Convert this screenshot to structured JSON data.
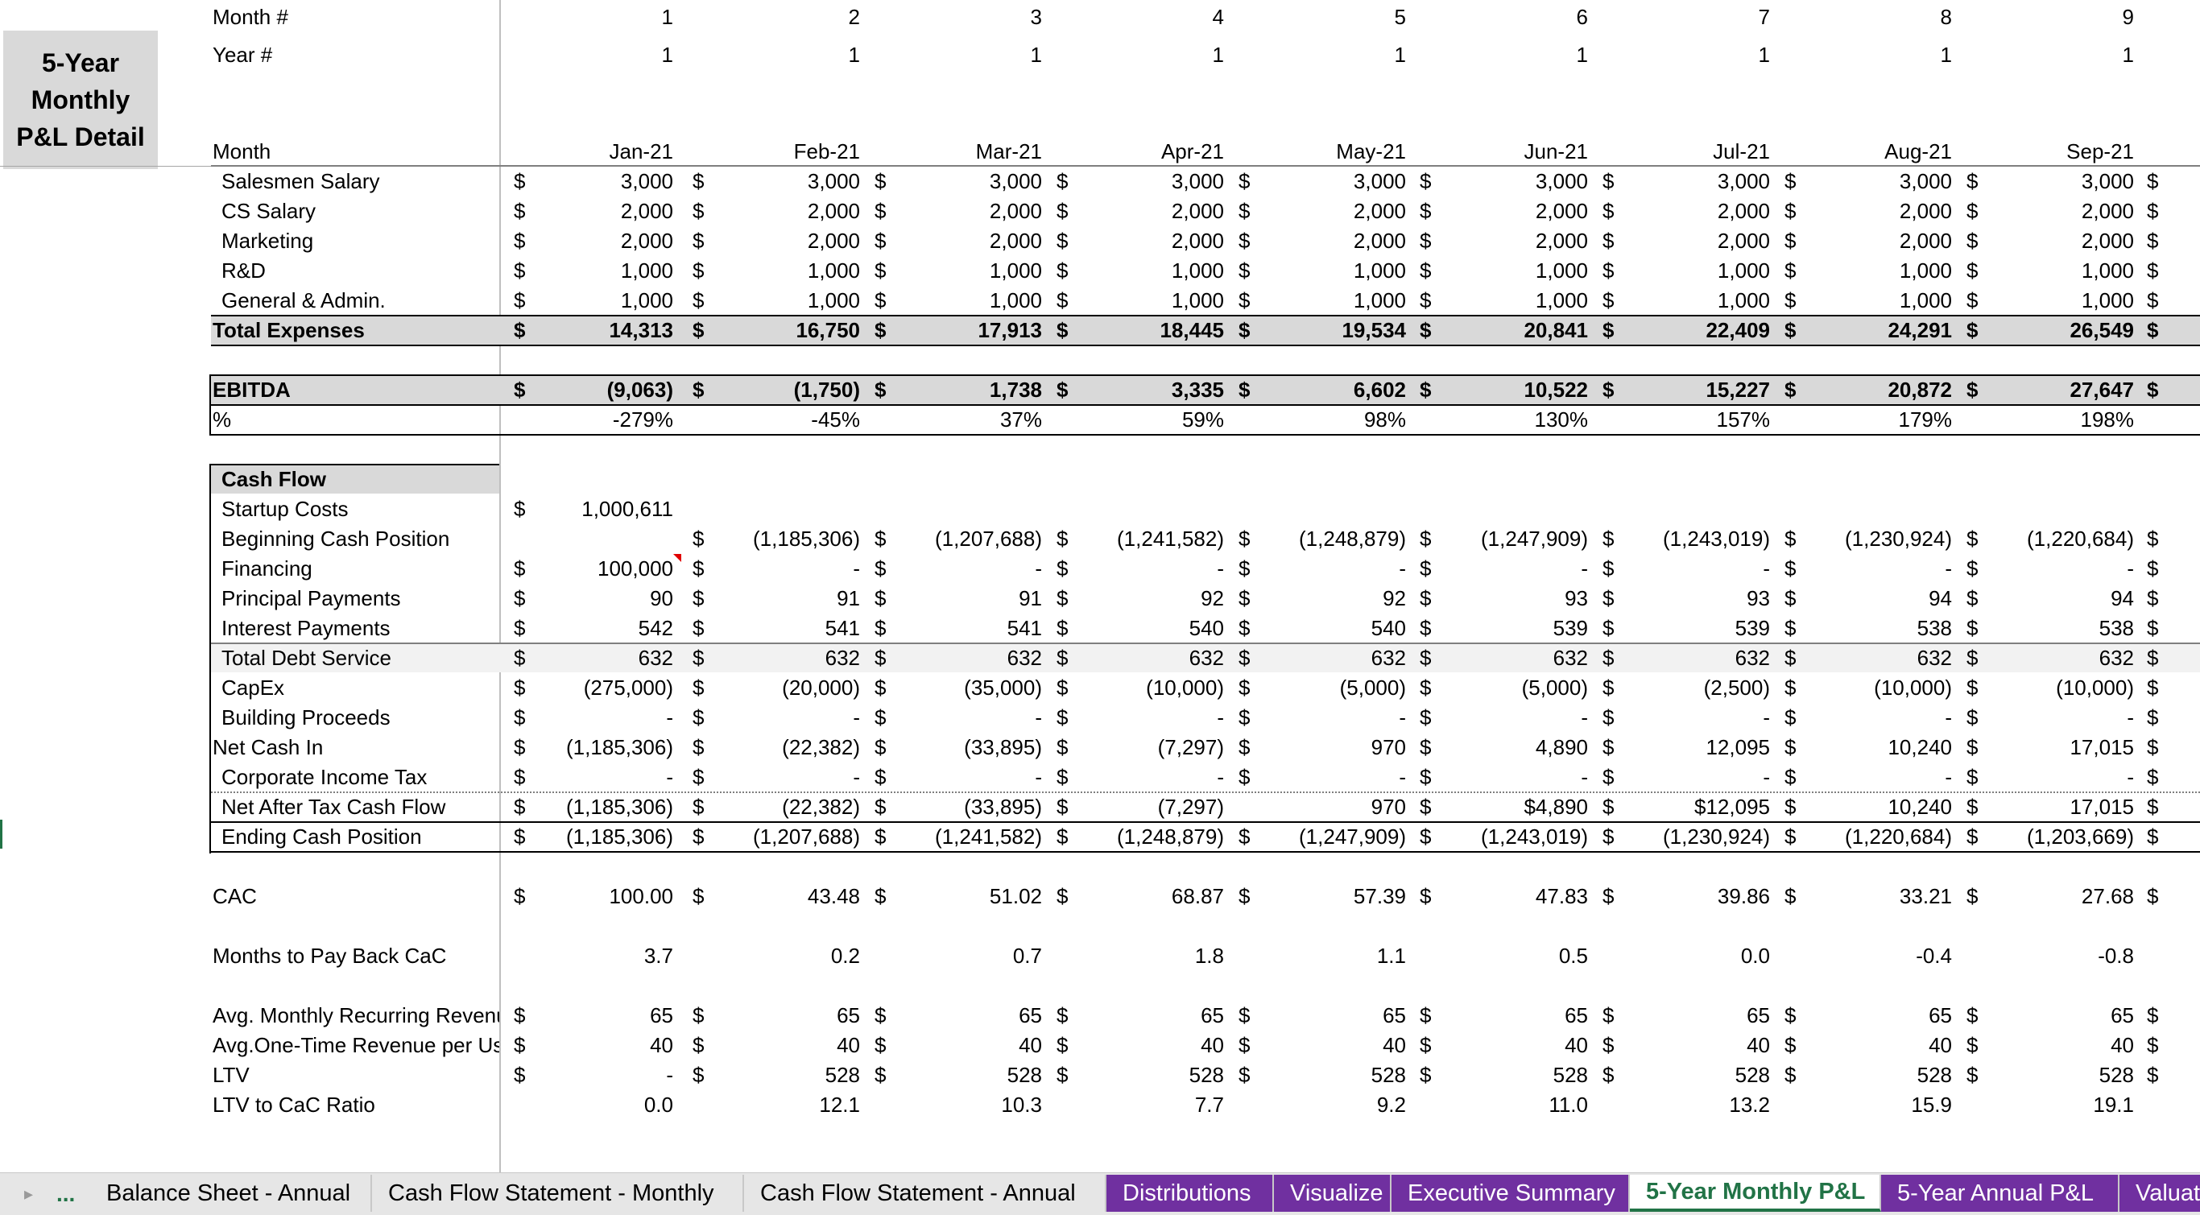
{
  "title_box": "5-Year\nMonthly\nP&L Detail",
  "header": {
    "month_num_label": "Month #",
    "month_nums": [
      "1",
      "2",
      "3",
      "4",
      "5",
      "6",
      "7",
      "8",
      "9"
    ],
    "year_num_label": "Year #",
    "year_nums": [
      "1",
      "1",
      "1",
      "1",
      "1",
      "1",
      "1",
      "1",
      "1"
    ],
    "month_label": "Month",
    "months": [
      "Jan-21",
      "Feb-21",
      "Mar-21",
      "Apr-21",
      "May-21",
      "Jun-21",
      "Jul-21",
      "Aug-21",
      "Sep-21"
    ]
  },
  "expenses": [
    {
      "label": "Salesmen Salary",
      "values": [
        "3,000",
        "3,000",
        "3,000",
        "3,000",
        "3,000",
        "3,000",
        "3,000",
        "3,000",
        "3,000"
      ]
    },
    {
      "label": "CS Salary",
      "values": [
        "2,000",
        "2,000",
        "2,000",
        "2,000",
        "2,000",
        "2,000",
        "2,000",
        "2,000",
        "2,000"
      ]
    },
    {
      "label": "Marketing",
      "values": [
        "2,000",
        "2,000",
        "2,000",
        "2,000",
        "2,000",
        "2,000",
        "2,000",
        "2,000",
        "2,000"
      ]
    },
    {
      "label": "R&D",
      "values": [
        "1,000",
        "1,000",
        "1,000",
        "1,000",
        "1,000",
        "1,000",
        "1,000",
        "1,000",
        "1,000"
      ]
    },
    {
      "label": "General & Admin.",
      "values": [
        "1,000",
        "1,000",
        "1,000",
        "1,000",
        "1,000",
        "1,000",
        "1,000",
        "1,000",
        "1,000"
      ]
    }
  ],
  "total_expenses": {
    "label": "Total Expenses",
    "values": [
      "14,313",
      "16,750",
      "17,913",
      "18,445",
      "19,534",
      "20,841",
      "22,409",
      "24,291",
      "26,549"
    ]
  },
  "ebitda": {
    "label": "EBITDA",
    "values": [
      "(9,063)",
      "(1,750)",
      "1,738",
      "3,335",
      "6,602",
      "10,522",
      "15,227",
      "20,872",
      "27,647"
    ]
  },
  "ebitda_pct": {
    "label": "%",
    "values": [
      "-279%",
      "-45%",
      "37%",
      "59%",
      "98%",
      "130%",
      "157%",
      "179%",
      "198%"
    ]
  },
  "cash_flow": {
    "header": "Cash Flow",
    "startup_costs": {
      "label": "Startup Costs",
      "values": [
        "1,000,611",
        "",
        "",
        "",
        "",
        "",
        "",
        "",
        ""
      ]
    },
    "beginning_cash": {
      "label": "Beginning Cash Position",
      "values": [
        "",
        "(1,185,306)",
        "(1,207,688)",
        "(1,241,582)",
        "(1,248,879)",
        "(1,247,909)",
        "(1,243,019)",
        "(1,230,924)",
        "(1,220,684)"
      ]
    },
    "financing": {
      "label": "Financing",
      "values": [
        "100,000",
        "-",
        "-",
        "-",
        "-",
        "-",
        "-",
        "-",
        "-"
      ]
    },
    "principal": {
      "label": "Principal Payments",
      "values": [
        "90",
        "91",
        "91",
        "92",
        "92",
        "93",
        "93",
        "94",
        "94"
      ]
    },
    "interest": {
      "label": "Interest Payments",
      "values": [
        "542",
        "541",
        "541",
        "540",
        "540",
        "539",
        "539",
        "538",
        "538"
      ]
    },
    "total_debt": {
      "label": "Total Debt Service",
      "values": [
        "632",
        "632",
        "632",
        "632",
        "632",
        "632",
        "632",
        "632",
        "632"
      ]
    },
    "capex": {
      "label": "CapEx",
      "values": [
        "(275,000)",
        "(20,000)",
        "(35,000)",
        "(10,000)",
        "(5,000)",
        "(5,000)",
        "(2,500)",
        "(10,000)",
        "(10,000)"
      ]
    },
    "building": {
      "label": "Building Proceeds",
      "values": [
        "-",
        "-",
        "-",
        "-",
        "-",
        "-",
        "-",
        "-",
        "-"
      ]
    },
    "net_cash_in": {
      "label": "Net Cash In",
      "values": [
        "(1,185,306)",
        "(22,382)",
        "(33,895)",
        "(7,297)",
        "970",
        "4,890",
        "12,095",
        "10,240",
        "17,015"
      ]
    },
    "corp_tax": {
      "label": "Corporate Income Tax",
      "values": [
        "-",
        "-",
        "-",
        "-",
        "-",
        "-",
        "-",
        "-",
        "-"
      ]
    },
    "net_after_tax": {
      "label": "Net After Tax Cash Flow",
      "values": [
        "(1,185,306)",
        "(22,382)",
        "(33,895)",
        "(7,297)",
        "970",
        "$4,890",
        "$12,095",
        "10,240",
        "17,015"
      ]
    },
    "ending_cash": {
      "label": "Ending Cash Position",
      "values": [
        "(1,185,306)",
        "(1,207,688)",
        "(1,241,582)",
        "(1,248,879)",
        "(1,247,909)",
        "(1,243,019)",
        "(1,230,924)",
        "(1,220,684)",
        "(1,203,669)"
      ]
    }
  },
  "metrics": {
    "cac": {
      "label": "CAC",
      "values": [
        "100.00",
        "43.48",
        "51.02",
        "68.87",
        "57.39",
        "47.83",
        "39.86",
        "33.21",
        "27.68"
      ]
    },
    "payback": {
      "label": "Months to Pay Back CaC",
      "values": [
        "3.7",
        "0.2",
        "0.7",
        "1.8",
        "1.1",
        "0.5",
        "0.0",
        "-0.4",
        "-0.8"
      ]
    },
    "mrr": {
      "label": "Avg. Monthly Recurring Revenue",
      "values": [
        "65",
        "65",
        "65",
        "65",
        "65",
        "65",
        "65",
        "65",
        "65"
      ]
    },
    "one_time": {
      "label": "Avg.One-Time Revenue per User",
      "values": [
        "40",
        "40",
        "40",
        "40",
        "40",
        "40",
        "40",
        "40",
        "40"
      ]
    },
    "ltv": {
      "label": "LTV",
      "values": [
        "-",
        "528",
        "528",
        "528",
        "528",
        "528",
        "528",
        "528",
        "528"
      ]
    },
    "ltv_cac": {
      "label": "LTV to CaC Ratio",
      "values": [
        "0.0",
        "12.1",
        "10.3",
        "7.7",
        "9.2",
        "11.0",
        "13.2",
        "15.9",
        "19.1"
      ]
    }
  },
  "dollar_sign": "$",
  "tabs": {
    "ellipsis": "...",
    "items": [
      {
        "label": "Balance Sheet - Annual",
        "style": "gray"
      },
      {
        "label": "Cash Flow Statement - Monthly",
        "style": "gray"
      },
      {
        "label": "Cash Flow Statement - Annual",
        "style": "gray"
      },
      {
        "label": "Distributions",
        "style": "purple"
      },
      {
        "label": "Visualize",
        "style": "purple"
      },
      {
        "label": "Executive Summary",
        "style": "purple"
      },
      {
        "label": "5-Year Monthly P&L",
        "style": "active"
      },
      {
        "label": "5-Year Annual P&L",
        "style": "purple"
      },
      {
        "label": "Valuati",
        "style": "purple"
      }
    ]
  },
  "colors": {
    "accent": "#217346",
    "tab_purple": "#7030a0",
    "shade": "#d9d9d9"
  }
}
